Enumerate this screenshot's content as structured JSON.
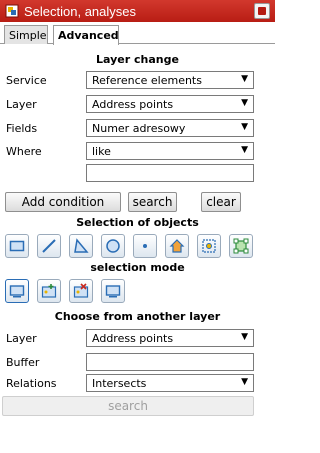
{
  "window": {
    "title": "Selection, analyses"
  },
  "tabs": [
    {
      "label": "Simple"
    },
    {
      "label": "Advanced"
    }
  ],
  "layer_change": {
    "heading": "Layer change",
    "service_label": "Service",
    "service_value": "Reference elements",
    "layer_label": "Layer",
    "layer_value": "Address points",
    "fields_label": "Fields",
    "fields_value": "Numer adresowy",
    "where_label": "Where",
    "where_value": "like",
    "value_input": "",
    "add_condition": "Add condition",
    "search": "search",
    "clear": "clear"
  },
  "selection_of_objects": {
    "heading": "Selection of objects",
    "tools": [
      "rectangle-select-icon",
      "line-select-icon",
      "polygon-select-icon",
      "circle-select-icon",
      "point-select-icon",
      "home-select-icon",
      "feature-select-icon",
      "extent-select-icon"
    ]
  },
  "selection_mode": {
    "heading": "selection mode",
    "modes": [
      "new-selection-icon",
      "add-to-selection-icon",
      "remove-from-selection-icon",
      "select-within-icon"
    ]
  },
  "other_layer": {
    "heading": "Choose from another layer",
    "layer_label": "Layer",
    "layer_value": "Address points",
    "buffer_label": "Buffer",
    "buffer_value": "",
    "relations_label": "Relations",
    "relations_value": "Intersects",
    "search": "search"
  },
  "colors": {
    "titlebar": "#c8291f",
    "tool_border": "#9aaabb",
    "tool_icon": "#2a6db5"
  }
}
